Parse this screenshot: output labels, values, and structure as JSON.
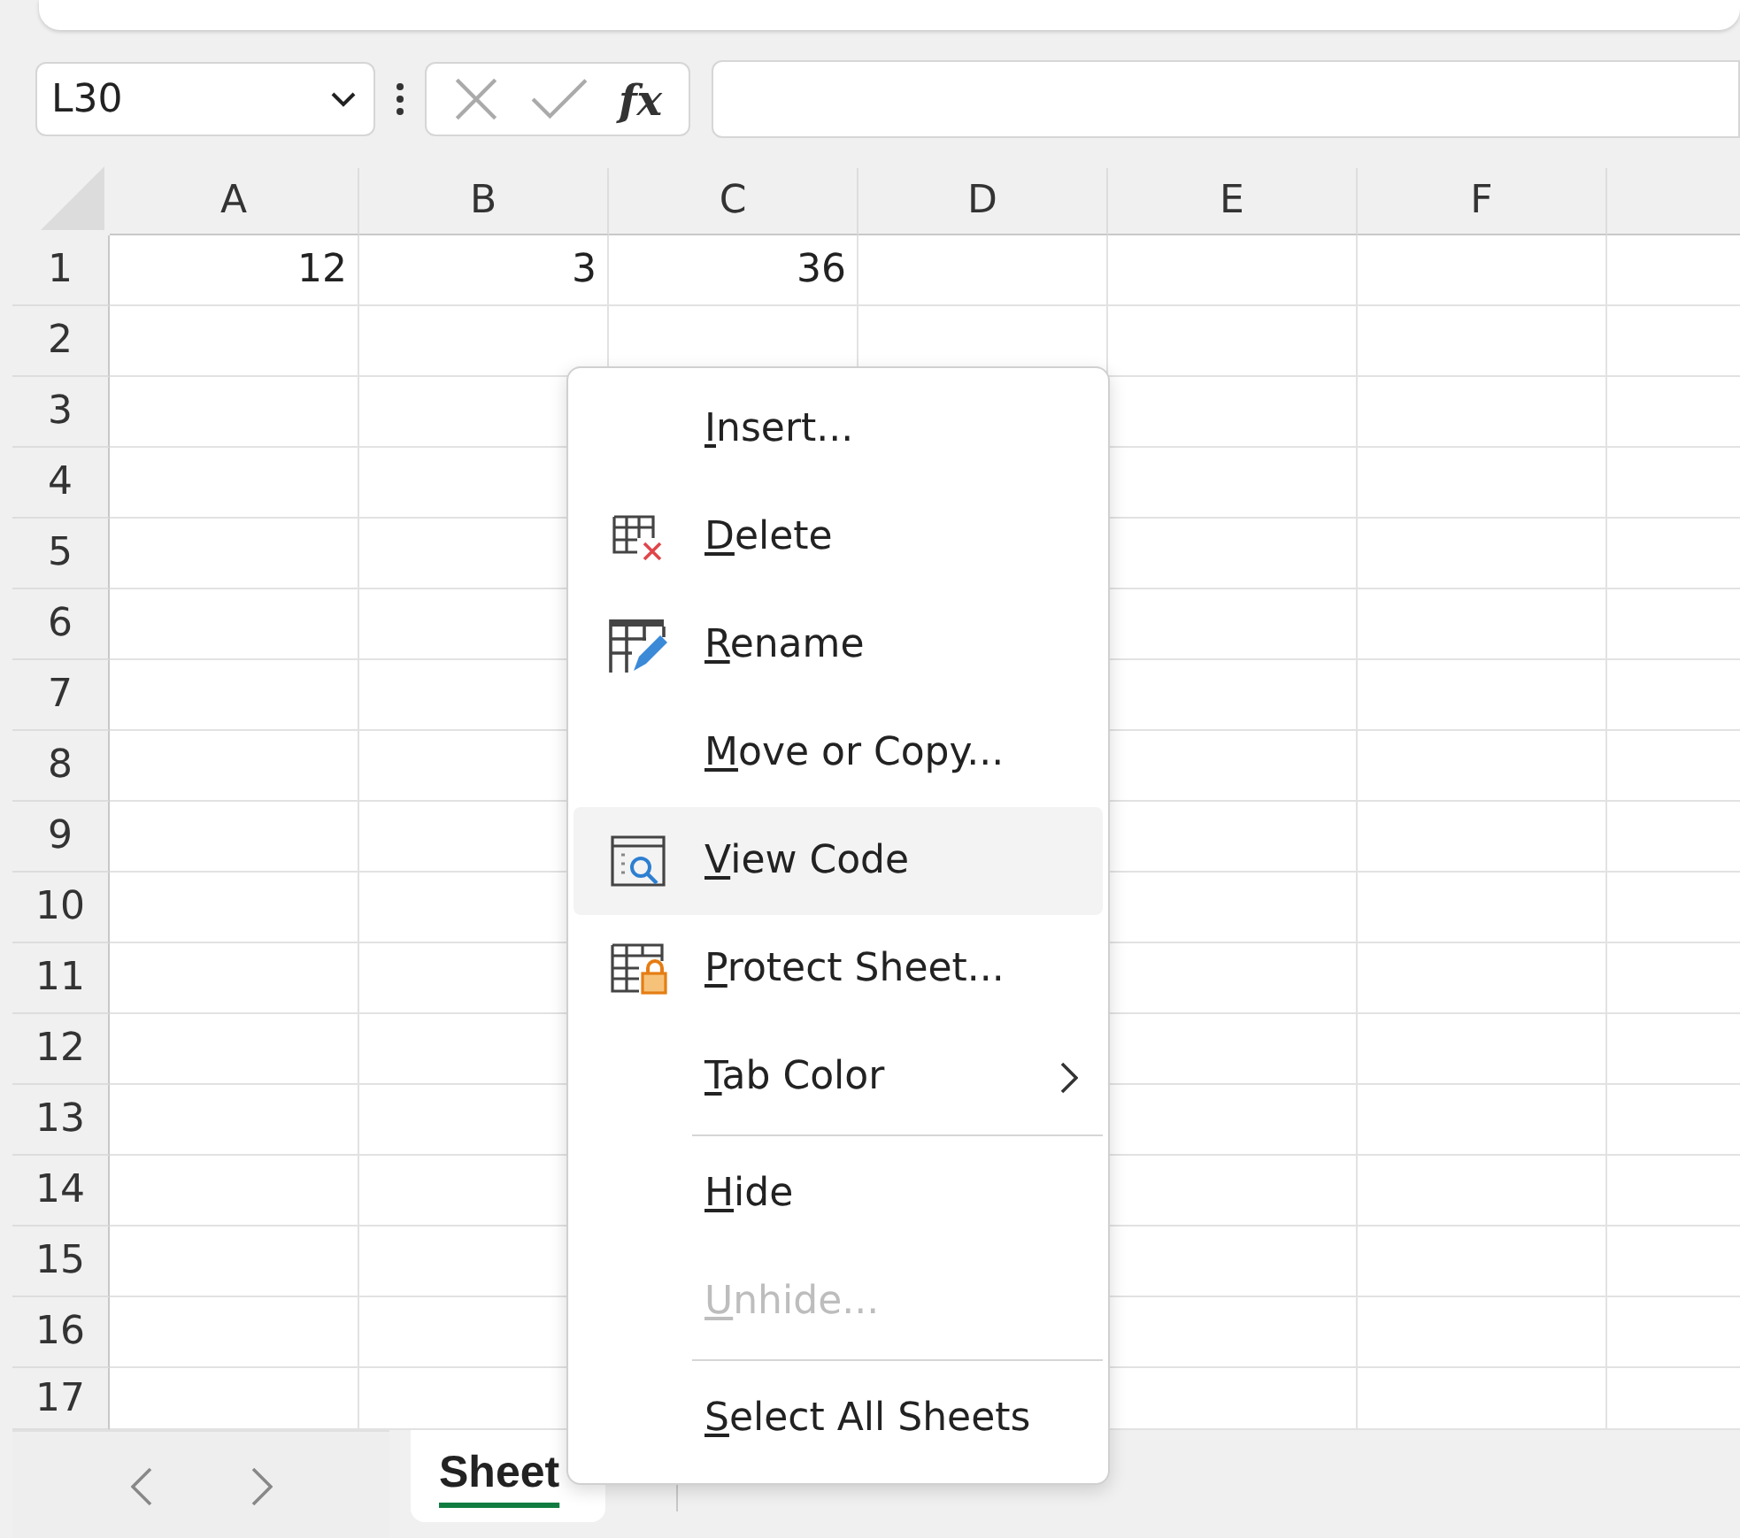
{
  "formula_bar": {
    "name_box": "L30",
    "fx": "fx"
  },
  "columns": [
    "A",
    "B",
    "C",
    "D",
    "E",
    "F"
  ],
  "rows": [
    {
      "label": "1",
      "cells": [
        "12",
        "3",
        "36"
      ]
    },
    {
      "label": "2"
    },
    {
      "label": "3"
    },
    {
      "label": "4"
    },
    {
      "label": "5"
    },
    {
      "label": "6"
    },
    {
      "label": "7"
    },
    {
      "label": "8"
    },
    {
      "label": "9"
    },
    {
      "label": "10"
    },
    {
      "label": "11"
    },
    {
      "label": "12"
    },
    {
      "label": "13"
    },
    {
      "label": "14"
    },
    {
      "label": "15"
    },
    {
      "label": "16"
    },
    {
      "label": "17"
    }
  ],
  "sheet_tabs": [
    {
      "label": "Sheet",
      "selected": true
    }
  ],
  "context_menu": [
    {
      "kind": "item",
      "label": "Insert...",
      "selected": false,
      "disabled": false
    },
    {
      "kind": "item",
      "label": "Delete",
      "selected": false,
      "disabled": false
    },
    {
      "kind": "item",
      "label": "Rename",
      "selected": false,
      "disabled": false
    },
    {
      "kind": "item",
      "label": "Move or Copy...",
      "selected": false,
      "disabled": false
    },
    {
      "kind": "item",
      "label": "View Code",
      "selected": true,
      "disabled": false
    },
    {
      "kind": "item",
      "label": "Protect Sheet...",
      "selected": false,
      "disabled": false
    },
    {
      "kind": "item",
      "label": "Tab Color",
      "submenu": true,
      "selected": false,
      "disabled": false
    },
    {
      "kind": "separator"
    },
    {
      "kind": "item",
      "label": "Hide",
      "selected": false,
      "disabled": false
    },
    {
      "kind": "item",
      "label": "Unhide...",
      "selected": false,
      "disabled": true
    },
    {
      "kind": "separator"
    },
    {
      "kind": "item",
      "label": "Select All Sheets",
      "selected": false,
      "disabled": false
    }
  ]
}
